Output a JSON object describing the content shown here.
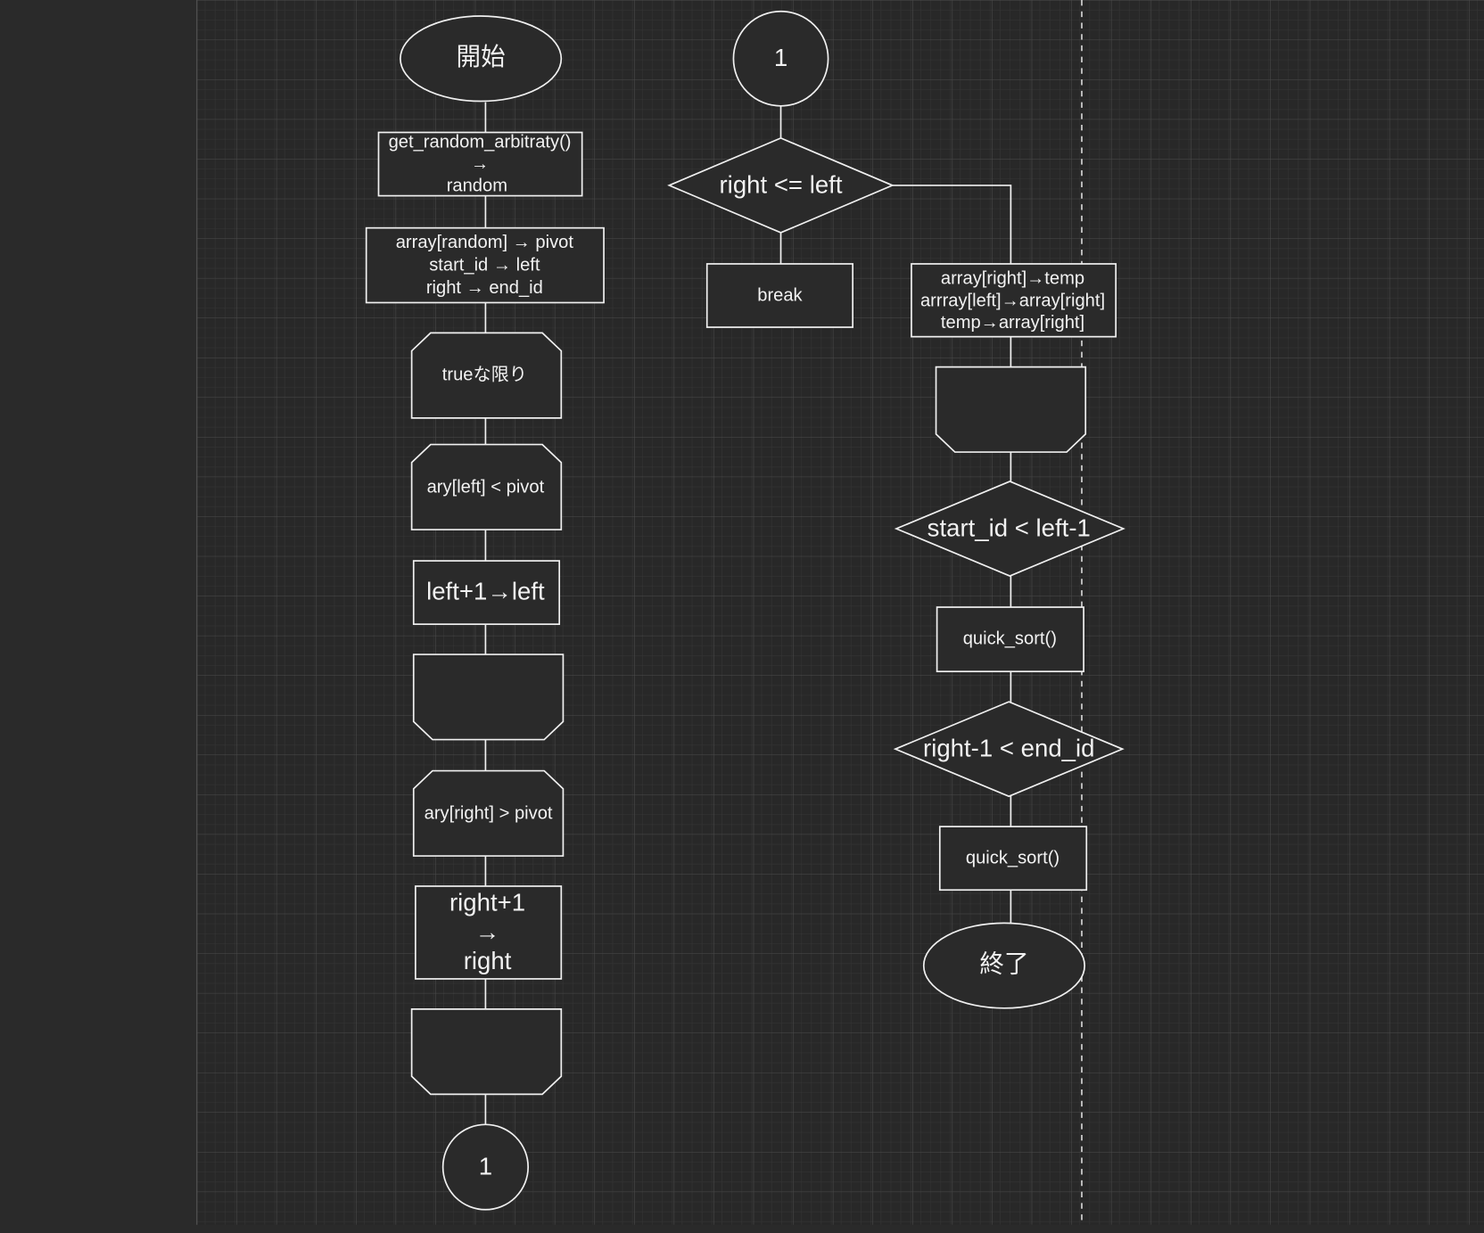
{
  "colors": {
    "canvas_bg": "#282828",
    "sidebar_bg": "#2a2a2a",
    "stroke": "#f0f0f0",
    "text": "#f2f2f2"
  },
  "left_column": {
    "start": "開始",
    "step1": [
      "get_random_arbitraty()",
      "→",
      "random"
    ],
    "step2": [
      "array[random] → pivot",
      "start_id → left",
      "right → end_id"
    ],
    "loop1_start": "trueな限り",
    "loop2_start": "ary[left] < pivot",
    "step3": "left+1→left",
    "loop2_end": "",
    "loop3_start": "ary[right] > pivot",
    "step4": [
      "right+1",
      "→",
      "right"
    ],
    "loop3_end": "",
    "connector": "1"
  },
  "right_column": {
    "connector": "1",
    "decision1": "right <= left",
    "break": "break",
    "swap": [
      "array[right]→temp",
      "arrray[left]→array[right]",
      "temp→array[right]"
    ],
    "loop1_end": "",
    "decision2": "start_id < left-1",
    "call1": "quick_sort()",
    "decision3": "right-1 < end_id",
    "call2": "quick_sort()",
    "end": "終了"
  }
}
